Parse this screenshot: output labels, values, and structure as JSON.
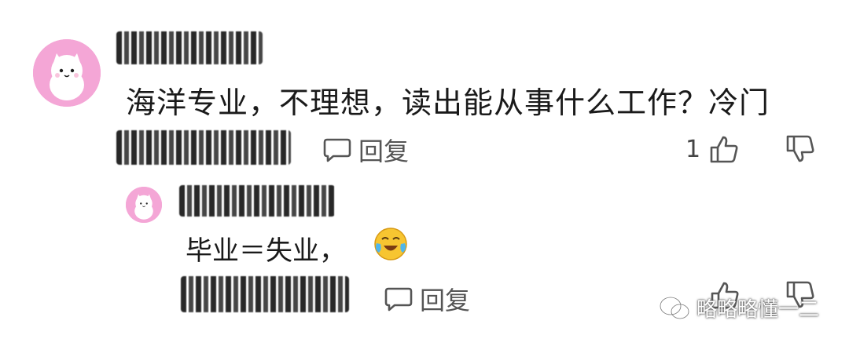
{
  "comment": {
    "text": "海洋专业，不理想，读出能从事什么工作？冷门",
    "reply_label": "回复",
    "like_count": "1"
  },
  "reply": {
    "text": "毕业＝失业，",
    "reply_label": "回复"
  },
  "watermark": {
    "text": "略略略懂一二"
  },
  "colors": {
    "avatar_bg": "#f4a6d6",
    "icon_gray": "#555555"
  }
}
